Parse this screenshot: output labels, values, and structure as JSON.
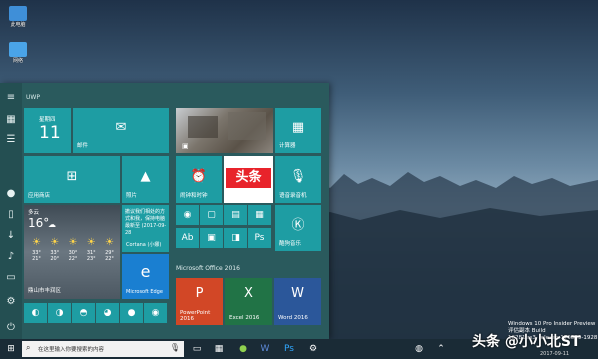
{
  "desktop": {
    "icons": [
      {
        "label": "此电脑"
      },
      {
        "label": "网络"
      }
    ],
    "watermark": {
      "line1": "Windows 10 Pro Insider Preview",
      "line2": "评估副本 Build 16281.rs3_release.170829-1928"
    },
    "brand_overlay": "头条 @小小北ST"
  },
  "start_menu": {
    "app_list_header": "UWP",
    "tiles": {
      "calendar": {
        "weekday": "星期四",
        "day": "11"
      },
      "mail": {
        "label": "邮件"
      },
      "photo_top": {
        "label": ""
      },
      "calculator": {
        "label": "计算器"
      },
      "store": {
        "label": "应用商店"
      },
      "photos": {
        "label": "照片"
      },
      "alarms": {
        "label": "闹钟和时钟"
      },
      "toutiao": {
        "label": "头条"
      },
      "voice_recorder": {
        "label": "语音录音机"
      },
      "weather": {
        "condition": "多云",
        "temp": "16°",
        "days": [
          {
            "hi": "33°",
            "lo": "21°"
          },
          {
            "hi": "33°",
            "lo": "20°"
          },
          {
            "hi": "30°",
            "lo": "22°"
          },
          {
            "hi": "31°",
            "lo": "23°"
          },
          {
            "hi": "29°",
            "lo": "22°"
          }
        ],
        "location": "鼎山市丰润区"
      },
      "cortana": {
        "line1": "撤议我们相处的方",
        "line2": "式和我，保持电脑",
        "line3": "最新至 (2017-09-28",
        "label": "Cortana (小娜)"
      },
      "edge": {
        "label": "Microsoft Edge"
      },
      "kugou": {
        "label": "酷狗音乐"
      }
    },
    "office_group_label": "Microsoft Office 2016",
    "office_tiles": [
      {
        "name": "PowerPoint",
        "line2": "2016",
        "color": "#d24726",
        "letter": "P"
      },
      {
        "name": "Excel 2016",
        "line2": "",
        "color": "#217346",
        "letter": "X"
      },
      {
        "name": "Word 2016",
        "line2": "",
        "color": "#2b579a",
        "letter": "W"
      }
    ]
  },
  "taskbar": {
    "search_placeholder": "在这里输入你要搜索的内容",
    "date": "2017-09-11"
  },
  "colors": {
    "tile_teal": "#1e9da3",
    "menu_bg": "#2a5a5d",
    "taskbar": "#1a2b36"
  }
}
